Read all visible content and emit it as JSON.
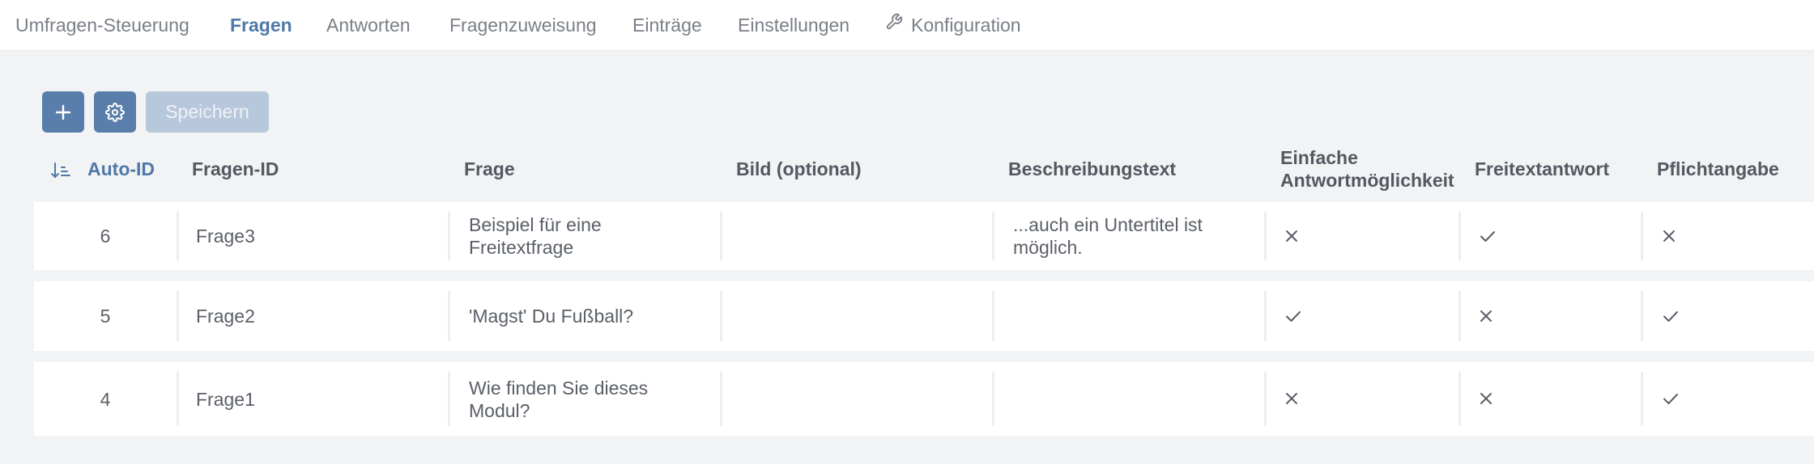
{
  "nav": {
    "tabs": [
      {
        "label": "Umfragen-Steuerung"
      },
      {
        "label": "Fragen"
      },
      {
        "label": "Antworten"
      },
      {
        "label": "Fragenzuweisung"
      },
      {
        "label": "Einträge"
      },
      {
        "label": "Einstellungen"
      },
      {
        "label": "Konfiguration",
        "icon": "wrench-icon"
      }
    ],
    "active_tab": "Fragen"
  },
  "toolbar": {
    "add_icon": "plus-icon",
    "settings_icon": "gear-icon",
    "save_label": "Speichern"
  },
  "table": {
    "columns": [
      {
        "label": "Auto-ID",
        "sorted": "descending"
      },
      {
        "label": "Fragen-ID"
      },
      {
        "label": "Frage"
      },
      {
        "label": "Bild (optional)"
      },
      {
        "label": "Beschreibungstext"
      },
      {
        "label": "Einfache Antwortmöglichkeit"
      },
      {
        "label": "Freitextantwort"
      },
      {
        "label": "Pflichtangabe"
      }
    ],
    "rows": [
      {
        "auto_id": "6",
        "fragen_id": "Frage3",
        "frage": "Beispiel für eine Freitextfrage",
        "bild": "",
        "beschreibung": "...auch ein Untertitel ist möglich.",
        "einfache": false,
        "freitext": true,
        "pflicht": false
      },
      {
        "auto_id": "5",
        "fragen_id": "Frage2",
        "frage": "'Magst' Du Fußball?",
        "bild": "",
        "beschreibung": "",
        "einfache": true,
        "freitext": false,
        "pflicht": true
      },
      {
        "auto_id": "4",
        "fragen_id": "Frage1",
        "frage": "Wie finden Sie dieses Modul?",
        "bild": "",
        "beschreibung": "",
        "einfache": false,
        "freitext": false,
        "pflicht": true
      }
    ]
  },
  "colors": {
    "accent": "#4f78a8",
    "button": "#5a7eab",
    "button_disabled": "#b8c8dc",
    "background": "#f2f3f5"
  }
}
